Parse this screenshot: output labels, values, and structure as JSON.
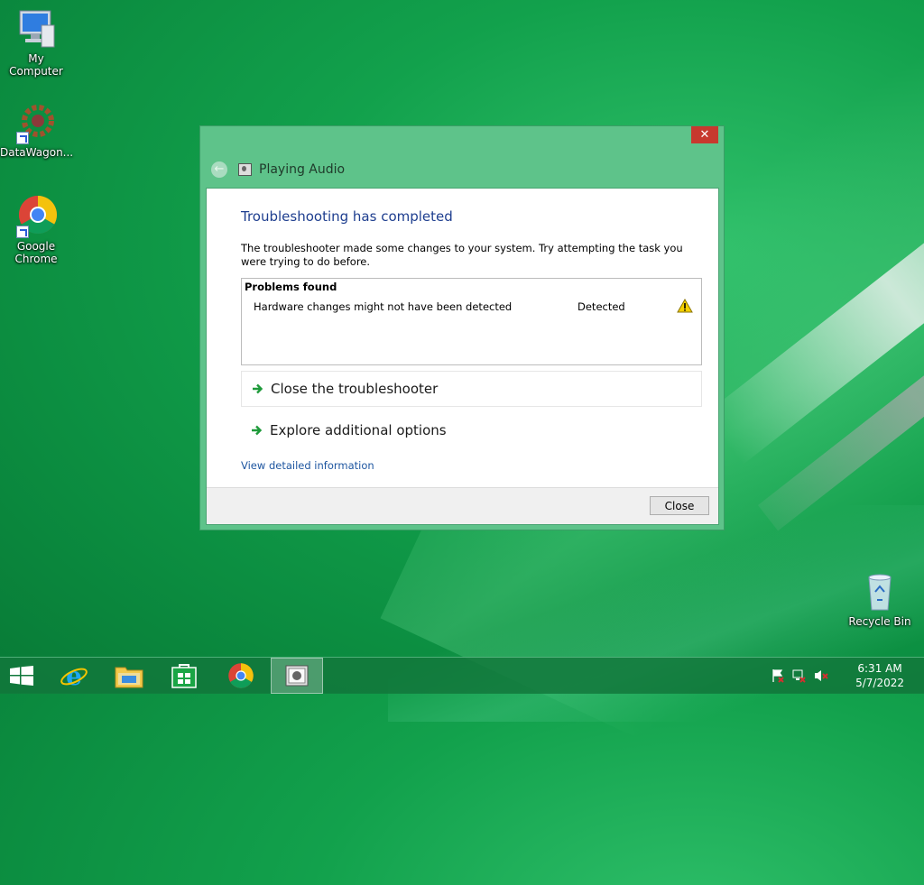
{
  "desktop": {
    "icons": [
      {
        "label": "My Computer"
      },
      {
        "label": "DataWagon..."
      },
      {
        "label": "Google Chrome"
      },
      {
        "label": "Recycle Bin"
      }
    ]
  },
  "dialog": {
    "close_glyph": "✕",
    "back_glyph": "←",
    "title": "Playing Audio",
    "heading": "Troubleshooting has completed",
    "description": "The troubleshooter made some changes to your system. Try attempting the task you were trying to do before.",
    "problems": {
      "header": "Problems found",
      "rows": [
        {
          "name": "Hardware changes might not have been detected",
          "status": "Detected",
          "icon": "warning-icon"
        }
      ]
    },
    "options": [
      {
        "label": "Close the troubleshooter",
        "icon": "green-arrow-icon"
      },
      {
        "label": "Explore additional options",
        "icon": "green-arrow-icon"
      }
    ],
    "link": "View detailed information",
    "close_button": "Close"
  },
  "taskbar": {
    "items": [
      "start",
      "internet-explorer",
      "file-explorer",
      "store",
      "chrome",
      "troubleshooter"
    ],
    "clock_time": "6:31 AM",
    "clock_date": "5/7/2022"
  },
  "colors": {
    "accent": "#5ec38a",
    "heading": "#1e3e8f",
    "link": "#1e56a0",
    "close_red": "#c7392e"
  }
}
